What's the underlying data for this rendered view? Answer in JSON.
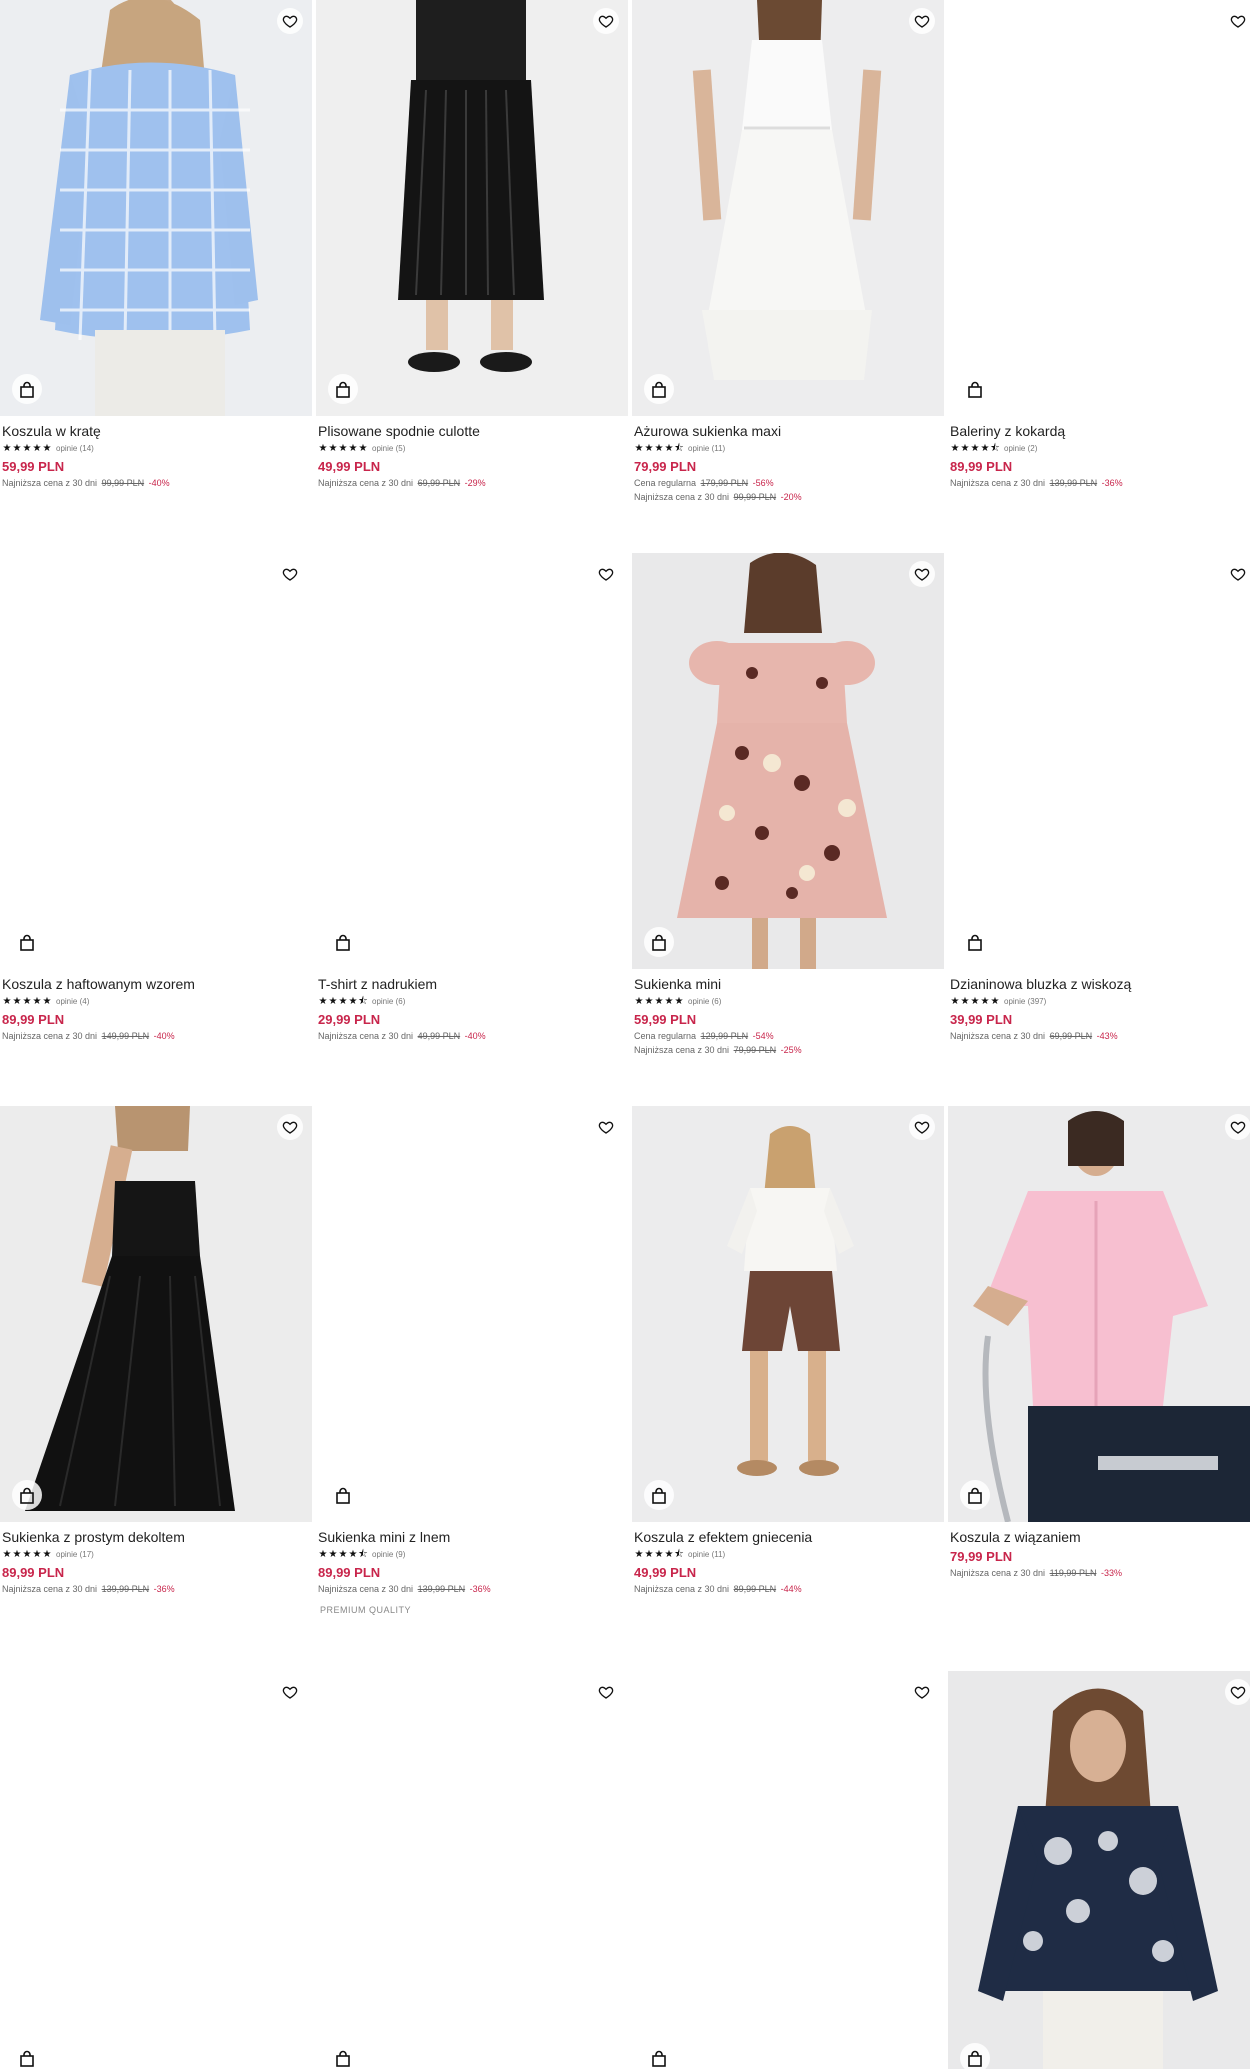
{
  "products": [
    {
      "name": "Koszula w kratę",
      "stars": 5,
      "reviews": "opinie (14)",
      "price": "59,99 PLN",
      "lines": [
        {
          "label": "Najniższa cena z 30 dni",
          "old": "99,99 PLN",
          "disc": "-40%"
        }
      ],
      "image": "blue-check-shirt"
    },
    {
      "name": "Plisowane spodnie culotte",
      "stars": 5,
      "reviews": "opinie (5)",
      "price": "49,99 PLN",
      "lines": [
        {
          "label": "Najniższa cena z 30 dni",
          "old": "69,99 PLN",
          "disc": "-29%"
        }
      ],
      "image": "black-pleated-culottes"
    },
    {
      "name": "Ażurowa sukienka maxi",
      "stars": 4.5,
      "reviews": "opinie (11)",
      "price": "79,99 PLN",
      "lines": [
        {
          "label": "Cena regularna",
          "old": "179,99 PLN",
          "disc": "-56%"
        },
        {
          "label": "Najniższa cena z 30 dni",
          "old": "99,99 PLN",
          "disc": "-20%"
        }
      ],
      "image": "white-maxi-dress"
    },
    {
      "name": "Baleriny z kokardą",
      "stars": 4.5,
      "reviews": "opinie (2)",
      "price": "89,99 PLN",
      "lines": [
        {
          "label": "Najniższa cena z 30 dni",
          "old": "139,99 PLN",
          "disc": "-36%"
        }
      ],
      "image": ""
    },
    {
      "name": "Koszula z haftowanym wzorem",
      "stars": 5,
      "reviews": "opinie (4)",
      "price": "89,99 PLN",
      "lines": [
        {
          "label": "Najniższa cena z 30 dni",
          "old": "149,99 PLN",
          "disc": "-40%"
        }
      ],
      "image": ""
    },
    {
      "name": "T-shirt z nadrukiem",
      "stars": 4.5,
      "reviews": "opinie (6)",
      "price": "29,99 PLN",
      "lines": [
        {
          "label": "Najniższa cena z 30 dni",
          "old": "49,99 PLN",
          "disc": "-40%"
        }
      ],
      "image": ""
    },
    {
      "name": "Sukienka mini",
      "stars": 5,
      "reviews": "opinie (6)",
      "price": "59,99 PLN",
      "lines": [
        {
          "label": "Cena regularna",
          "old": "129,99 PLN",
          "disc": "-54%"
        },
        {
          "label": "Najniższa cena z 30 dni",
          "old": "79,99 PLN",
          "disc": "-25%"
        }
      ],
      "image": "pink-floral-mini-dress"
    },
    {
      "name": "Dzianinowa bluzka z wiskozą",
      "stars": 5,
      "reviews": "opinie (397)",
      "price": "39,99 PLN",
      "lines": [
        {
          "label": "Najniższa cena z 30 dni",
          "old": "69,99 PLN",
          "disc": "-43%"
        }
      ],
      "image": ""
    },
    {
      "name": "Sukienka z prostym dekoltem",
      "stars": 5,
      "reviews": "opinie (17)",
      "price": "89,99 PLN",
      "lines": [
        {
          "label": "Najniższa cena z 30 dni",
          "old": "139,99 PLN",
          "disc": "-36%"
        }
      ],
      "image": "black-strapless-dress"
    },
    {
      "name": "Sukienka mini z lnem",
      "stars": 4.5,
      "reviews": "opinie (9)",
      "price": "89,99 PLN",
      "lines": [
        {
          "label": "Najniższa cena z 30 dni",
          "old": "139,99 PLN",
          "disc": "-36%"
        }
      ],
      "badge": "PREMIUM QUALITY",
      "image": ""
    },
    {
      "name": "Koszula z efektem gniecenia",
      "stars": 4.5,
      "reviews": "opinie (11)",
      "price": "49,99 PLN",
      "lines": [
        {
          "label": "Najniższa cena z 30 dni",
          "old": "89,99 PLN",
          "disc": "-44%"
        }
      ],
      "image": "white-shirt-brown-shorts"
    },
    {
      "name": "Koszula z wiązaniem",
      "stars": 0,
      "reviews": "",
      "price": "79,99 PLN",
      "lines": [
        {
          "label": "Najniższa cena z 30 dni",
          "old": "119,99 PLN",
          "disc": "-33%"
        }
      ],
      "image": "pink-tie-shirt"
    },
    {
      "name": "",
      "stars": 0,
      "reviews": "",
      "price": "",
      "lines": [],
      "image": ""
    },
    {
      "name": "",
      "stars": 0,
      "reviews": "",
      "price": "",
      "lines": [],
      "image": ""
    },
    {
      "name": "",
      "stars": 0,
      "reviews": "",
      "price": "",
      "lines": [],
      "image": ""
    },
    {
      "name": "",
      "stars": 0,
      "reviews": "",
      "price": "",
      "lines": [],
      "image": "navy-embroidered-blouse"
    }
  ],
  "icons": {
    "wishlist": "heart-icon",
    "cart": "shopping-bag-icon"
  },
  "colors": {
    "price": "#c8254b",
    "discount": "#c8254b"
  }
}
